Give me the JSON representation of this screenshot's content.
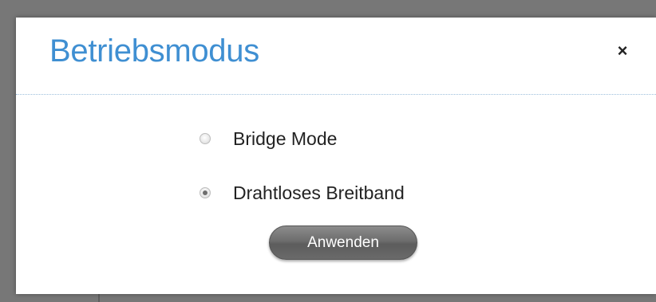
{
  "dialog": {
    "title": "Betriebsmodus",
    "close_symbol": "×",
    "options": [
      {
        "label": "Bridge Mode",
        "selected": false
      },
      {
        "label": "Drahtloses Breitband",
        "selected": true
      }
    ],
    "apply_label": "Anwenden"
  },
  "colors": {
    "title": "#3f8fd2",
    "overlay": "#777777",
    "button": "#6d6d6d"
  },
  "icons": {
    "close": "close-icon"
  }
}
